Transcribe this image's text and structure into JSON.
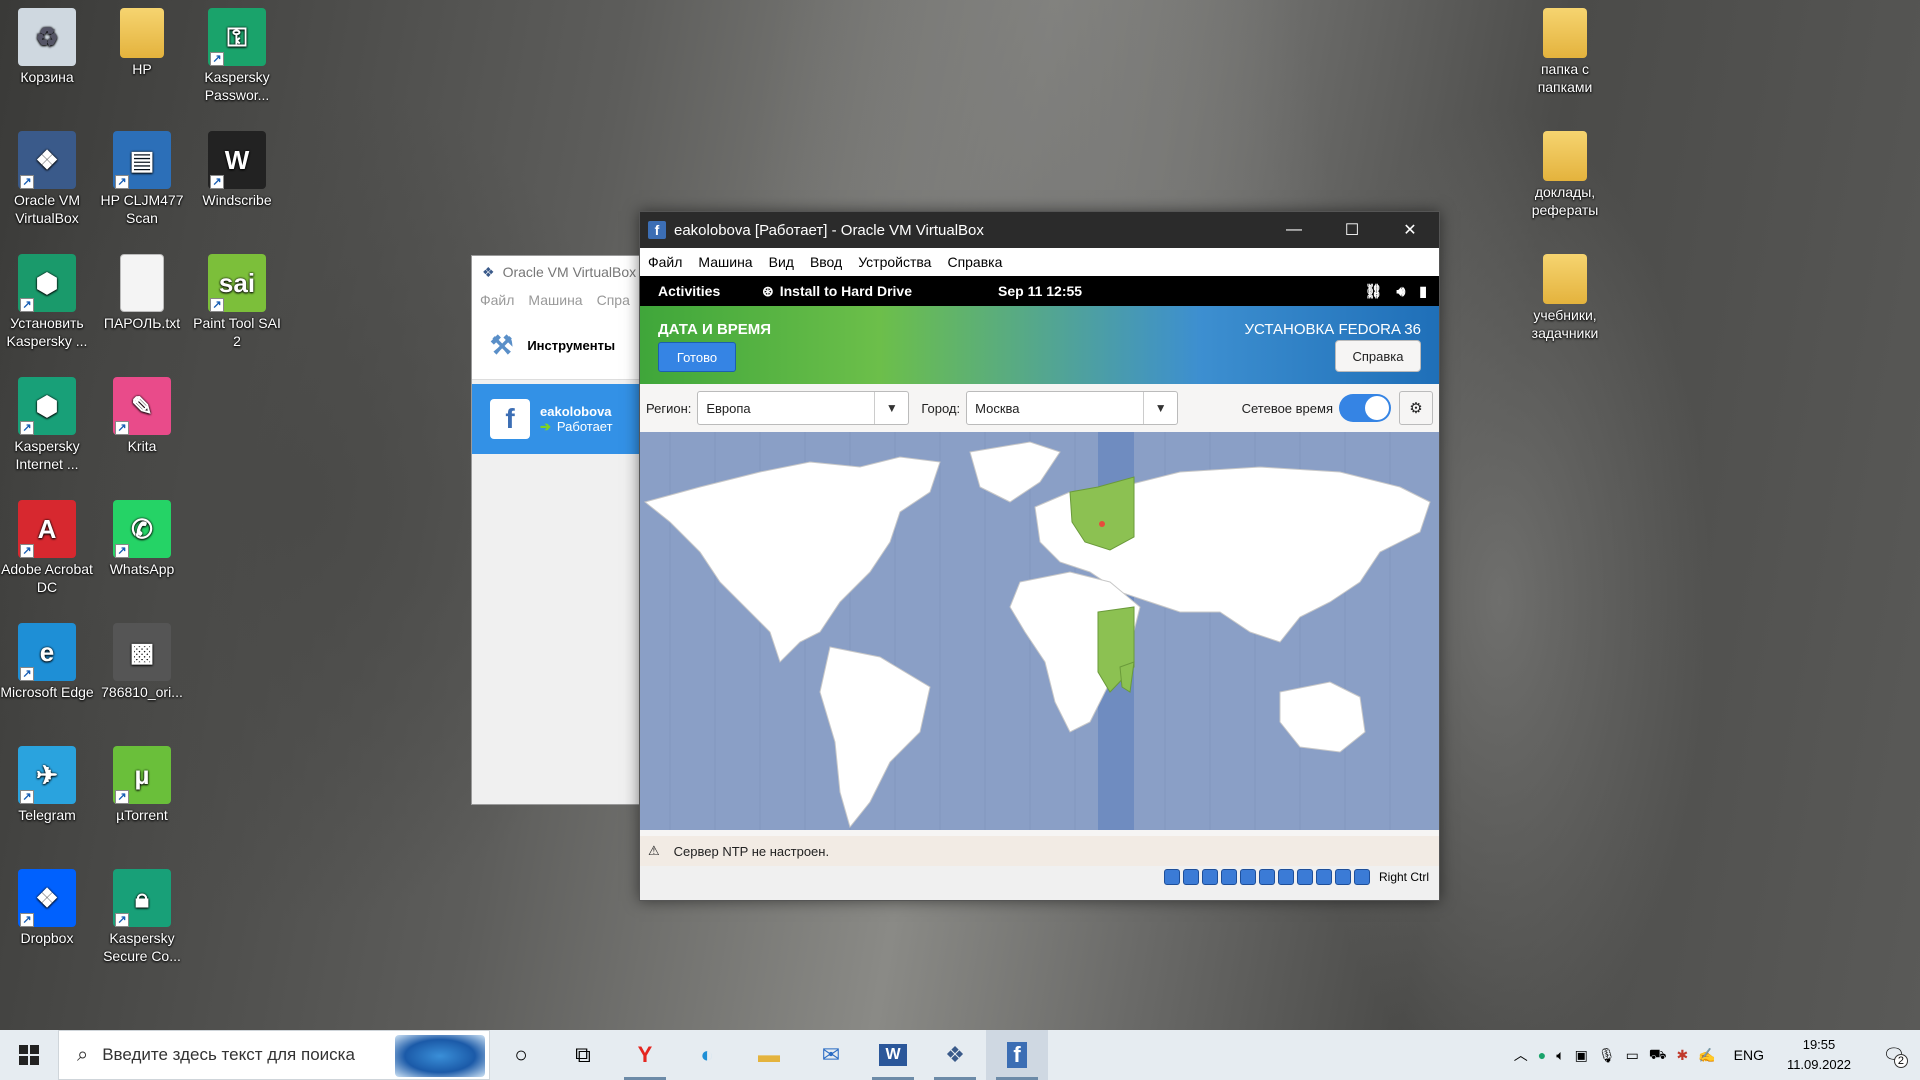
{
  "desktop_icons": [
    {
      "label": "Корзина",
      "icon": "recycle-bin-icon"
    },
    {
      "label": "HP",
      "icon": "folder-icon"
    },
    {
      "label": "Kaspersky Passwor...",
      "icon": "kaspersky-password-icon"
    },
    {
      "label": "Oracle VM VirtualBox",
      "icon": "virtualbox-icon"
    },
    {
      "label": "HP CLJM477 Scan",
      "icon": "scanner-icon"
    },
    {
      "label": "Windscribe",
      "icon": "windscribe-icon"
    },
    {
      "label": "Установить Kaspersky ...",
      "icon": "kaspersky-install-icon"
    },
    {
      "label": "ПАРОЛЬ.txt",
      "icon": "text-file-icon"
    },
    {
      "label": "Paint Tool SAI 2",
      "icon": "sai-icon"
    },
    {
      "label": "Kaspersky Internet ...",
      "icon": "kaspersky-internet-icon"
    },
    {
      "label": "Krita",
      "icon": "krita-icon"
    },
    {
      "label": "Adobe Acrobat DC",
      "icon": "acrobat-icon"
    },
    {
      "label": "WhatsApp",
      "icon": "whatsapp-icon"
    },
    {
      "label": "Microsoft Edge",
      "icon": "edge-icon"
    },
    {
      "label": "786810_ori...",
      "icon": "image-file-icon"
    },
    {
      "label": "Telegram",
      "icon": "telegram-icon"
    },
    {
      "label": "µTorrent",
      "icon": "utorrent-icon"
    },
    {
      "label": "Dropbox",
      "icon": "dropbox-icon"
    },
    {
      "label": "Kaspersky Secure Co...",
      "icon": "kaspersky-vpn-icon"
    },
    {
      "label": "папка с папками",
      "icon": "folder-icon"
    },
    {
      "label": "доклады, рефераты",
      "icon": "folder-icon"
    },
    {
      "label": "учебники, задачники",
      "icon": "folder-icon"
    }
  ],
  "vbox_manager": {
    "title": "Oracle VM VirtualBox",
    "menu": [
      "Файл",
      "Машина",
      "Спра"
    ],
    "tools_label": "Инструменты",
    "vm_name": "eakolobova",
    "vm_state": "Работает"
  },
  "vm_window": {
    "title": "eakolobova [Работает] - Oracle VM VirtualBox",
    "menu": [
      "Файл",
      "Машина",
      "Вид",
      "Ввод",
      "Устройства",
      "Справка"
    ],
    "gnome": {
      "activities": "Activities",
      "app": "Install to Hard Drive",
      "clock": "Sep 11  12:55"
    },
    "anaconda": {
      "section_title": "ДАТА И ВРЕМЯ",
      "done_button": "Готово",
      "product": "УСТАНОВКА FEDORA 36",
      "help_button": "Справка",
      "region_label": "Регион:",
      "region_value": "Европа",
      "city_label": "Город:",
      "city_value": "Москва",
      "network_time_label": "Сетевое время",
      "network_time_on": true,
      "warning": "Сервер NTP не настроен."
    },
    "status_host_key": "Right Ctrl"
  },
  "taskbar": {
    "search_placeholder": "Введите здесь текст для поиска",
    "lang": "ENG",
    "time": "19:55",
    "date": "11.09.2022",
    "notifications": "2"
  },
  "colors": {
    "accent": "#3584e4",
    "map_ocean": "#8a9fc6",
    "map_land": "#ffffff",
    "map_highlight": "#8cc152"
  }
}
